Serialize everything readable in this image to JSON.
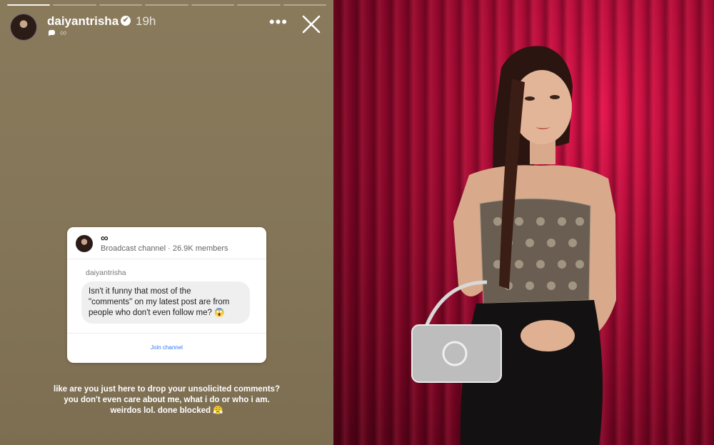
{
  "story": {
    "username": "daiyantrisha",
    "verified_mark": "✔",
    "time_ago": "19h",
    "subtitle": "∞",
    "progress_segments": 7,
    "progress_done": 1,
    "icons": [
      "avatar",
      "verified-badge-icon",
      "broadcast-icon",
      "more-icon",
      "close-icon"
    ]
  },
  "card": {
    "channel_symbol": "∞",
    "channel_meta": "Broadcast channel · 26.9K members",
    "sender": "daiyantrisha",
    "message_lines": [
      "Isn't it funny that most of the",
      "\"comments\" on my latest post are from",
      "people who don't even follow me? 😱"
    ],
    "join_label": "Join channel"
  },
  "caption": {
    "lines": [
      "like are you just here to drop your unsolicited comments?",
      "you don't even care about me, what i do or who i am.",
      "weirdos lol. done blocked 😤"
    ]
  },
  "colors": {
    "story_bg": "#857659",
    "curtain": "#a80b35",
    "link_blue": "#3478f6"
  }
}
